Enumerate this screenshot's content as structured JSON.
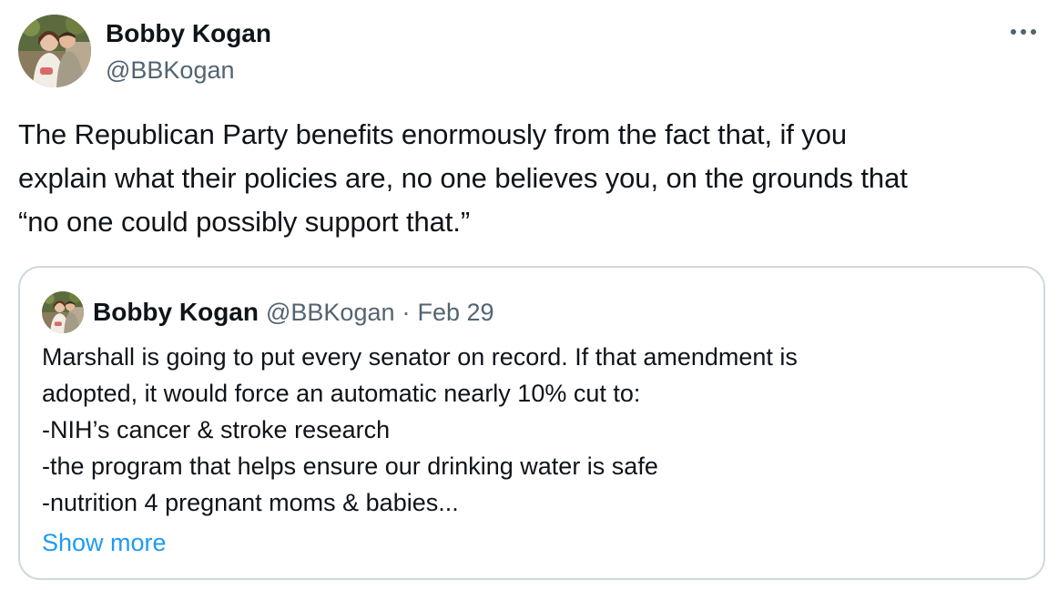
{
  "author": {
    "display_name": "Bobby Kogan",
    "handle": "@BBKogan",
    "avatar_icon": "profile-photo"
  },
  "more_icon": "more-horizontal-icon",
  "tweet": {
    "text": "The Republican Party benefits enormously from the fact that, if you\nexplain what their policies are, no one believes you, on the grounds that\n“no one could possibly support that.”"
  },
  "quote": {
    "display_name": "Bobby Kogan",
    "handle": "@BBKogan",
    "separator": "·",
    "date": "Feb 29",
    "lines": [
      "Marshall is going to put every senator on record. If that amendment is",
      "adopted, it would force an automatic nearly 10% cut to:",
      "-NIH’s cancer & stroke research",
      "-the program that helps ensure our drinking water is safe",
      "-nutrition 4 pregnant moms & babies..."
    ],
    "show_more": "Show more"
  },
  "colors": {
    "text_primary": "#0f1419",
    "text_secondary": "#536471",
    "link": "#1d9bf0",
    "border": "#cfd9de"
  }
}
